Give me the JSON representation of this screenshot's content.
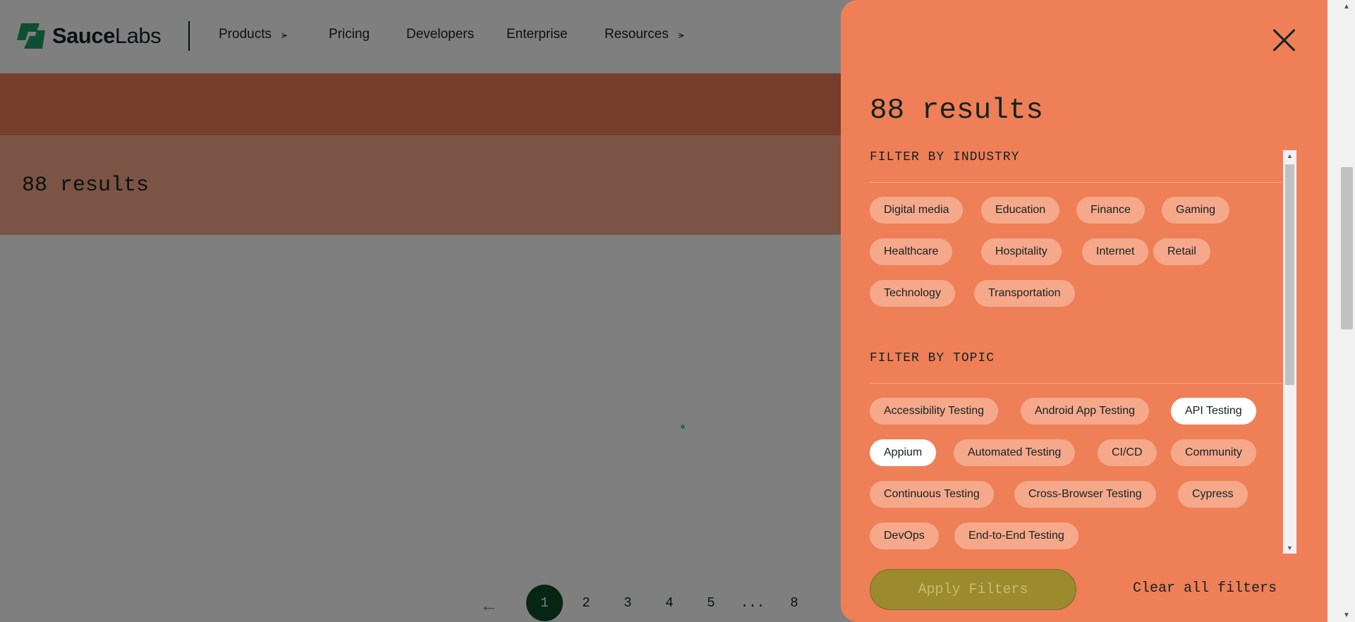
{
  "header": {
    "logo_bold": "Sauce",
    "logo_light": "Labs",
    "nav": [
      {
        "label": "Products",
        "has_menu": true
      },
      {
        "label": "Pricing",
        "has_menu": false
      },
      {
        "label": "Developers",
        "has_menu": false
      },
      {
        "label": "Enterprise",
        "has_menu": false
      },
      {
        "label": "Resources",
        "has_menu": true
      }
    ]
  },
  "page": {
    "results_text": "88 results"
  },
  "pagination": {
    "prev_icon": "arrow-left-icon",
    "pages": [
      "1",
      "2",
      "3",
      "4",
      "5",
      "...",
      "8"
    ],
    "active_page": "1"
  },
  "drawer": {
    "close_icon": "close-icon",
    "title": "88 results",
    "industry": {
      "title": "FILTER BY INDUSTRY",
      "options": [
        {
          "label": "Digital media",
          "selected": false
        },
        {
          "label": "Education",
          "selected": false
        },
        {
          "label": "Finance",
          "selected": false
        },
        {
          "label": "Gaming",
          "selected": false
        },
        {
          "label": "Healthcare",
          "selected": false
        },
        {
          "label": "Hospitality",
          "selected": false
        },
        {
          "label": "Internet",
          "selected": false
        },
        {
          "label": "Retail",
          "selected": false
        },
        {
          "label": "Technology",
          "selected": false
        },
        {
          "label": "Transportation",
          "selected": false
        }
      ]
    },
    "topic": {
      "title": "FILTER BY TOPIC",
      "options": [
        {
          "label": "Accessibility Testing",
          "selected": false
        },
        {
          "label": "Android App Testing",
          "selected": false
        },
        {
          "label": "API Testing",
          "selected": true
        },
        {
          "label": "Appium",
          "selected": true
        },
        {
          "label": "Automated Testing",
          "selected": false
        },
        {
          "label": "CI/CD",
          "selected": false
        },
        {
          "label": "Community",
          "selected": false
        },
        {
          "label": "Continuous Testing",
          "selected": false
        },
        {
          "label": "Cross-Browser Testing",
          "selected": false
        },
        {
          "label": "Cypress",
          "selected": false
        },
        {
          "label": "DevOps",
          "selected": false
        },
        {
          "label": "End-to-End Testing",
          "selected": false
        }
      ]
    },
    "apply_label": "Apply Filters",
    "clear_label": "Clear all filters"
  },
  "colors": {
    "drawer_bg": "#ef7f57",
    "pill_bg": "#f6a88b",
    "pill_selected_bg": "#ffffff",
    "active_page_bg": "#0d4a2a",
    "apply_bg": "#9b8a2e",
    "text_dark": "#132322",
    "logo_green": "#3ddc97"
  }
}
